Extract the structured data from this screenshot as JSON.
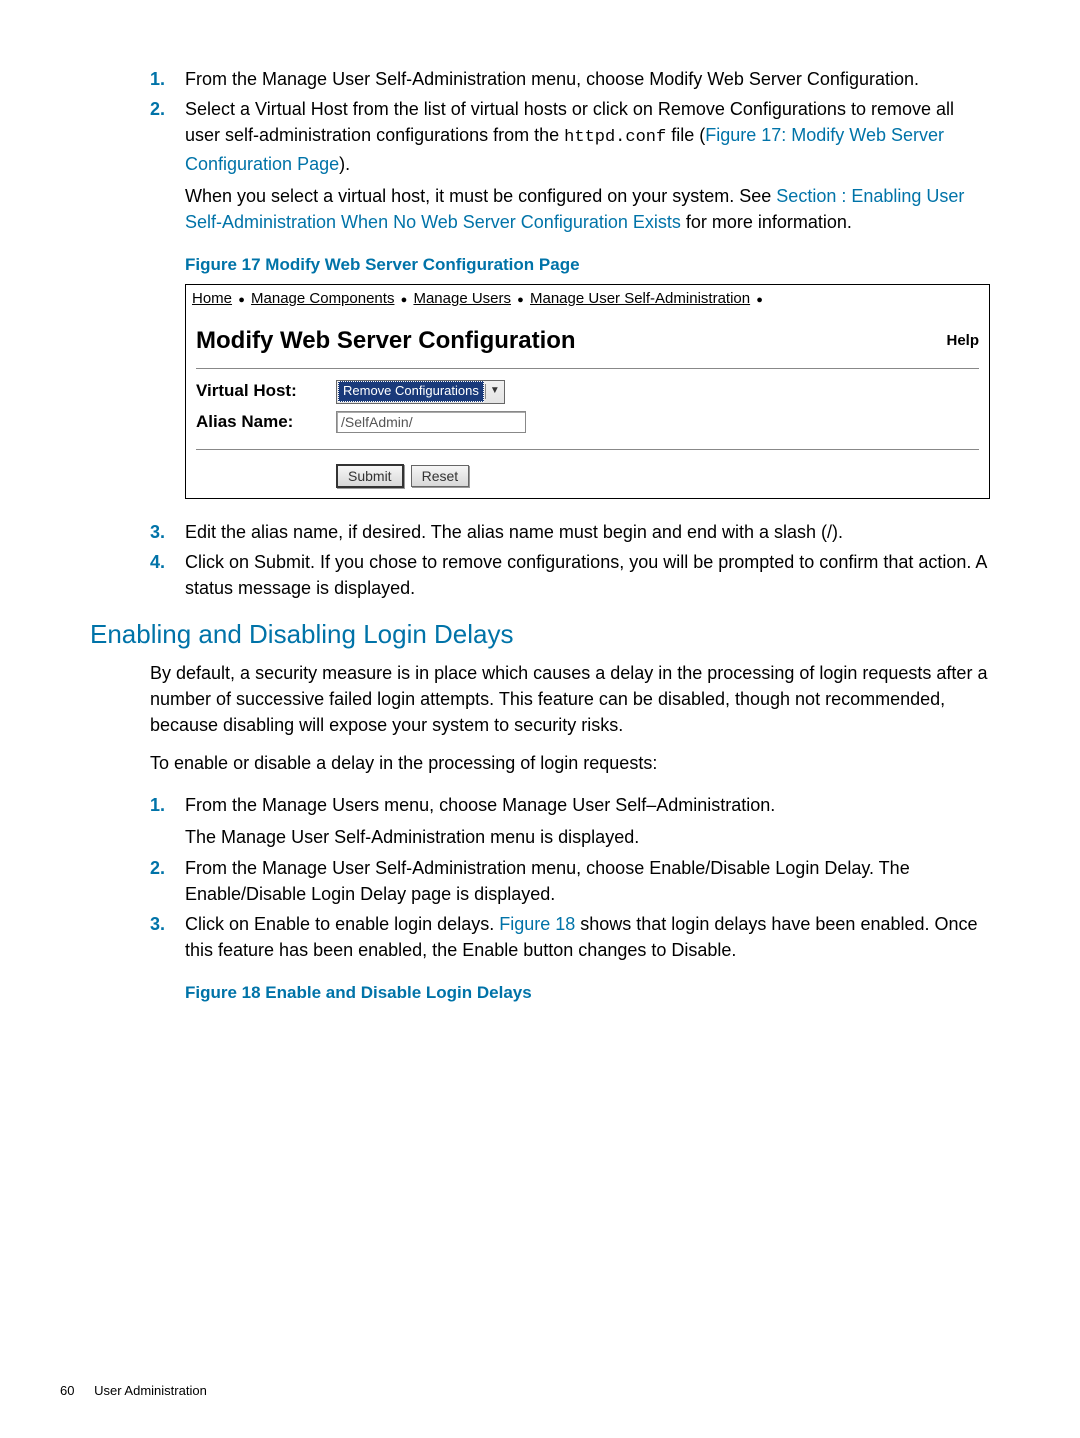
{
  "steps_top": [
    {
      "num": "1.",
      "text": "From the Manage User Self-Administration menu, choose Modify Web Server Configuration."
    },
    {
      "num": "2.",
      "text_before": "Select a Virtual Host from the list of virtual hosts or click on Remove Configurations to remove all user self-administration configurations from the ",
      "code": "httpd.conf",
      "text_after": " file (",
      "link1": "Figure 17: Modify Web Server Configuration Page",
      "tail": ").",
      "para2_before": "When you select a virtual host, it must be configured on your system. See ",
      "para2_link": "Section : Enabling User Self-Administration When No Web Server Configuration Exists",
      "para2_after": " for more information."
    }
  ],
  "fig17": {
    "caption": "Figure 17 Modify Web Server Configuration Page",
    "breadcrumb": [
      "Home",
      "Manage Components",
      "Manage Users",
      "Manage User Self-Administration"
    ],
    "title": "Modify Web Server Configuration",
    "help": "Help",
    "label_vhost": "Virtual Host:",
    "label_alias": "Alias Name:",
    "select_value": "Remove Configurations",
    "input_value": "/SelfAdmin/",
    "btn_submit": "Submit",
    "btn_reset": "Reset"
  },
  "steps_mid": [
    {
      "num": "3.",
      "text": "Edit the alias name, if desired. The alias name must begin and end with a slash (/)."
    },
    {
      "num": "4.",
      "text": "Click on Submit. If you chose to remove configurations, you will be prompted to confirm that action. A status message is displayed."
    }
  ],
  "heading2": "Enabling and Disabling Login Delays",
  "para1": "By default, a security measure is in place which causes a delay in the processing of login requests after a number of successive failed login attempts. This feature can be disabled, though not recommended, because disabling will expose your system to security risks.",
  "para2": "To enable or disable a delay in the processing of login requests:",
  "steps_bot": [
    {
      "num": "1.",
      "text": "From the Manage Users menu, choose Manage User Self–Administration.",
      "sub": "The Manage User Self-Administration menu is displayed."
    },
    {
      "num": "2.",
      "text": "From the Manage User Self-Administration menu, choose Enable/Disable Login Delay. The Enable/Disable Login Delay page is displayed."
    },
    {
      "num": "3.",
      "before": "Click on Enable to enable login delays. ",
      "link": "Figure 18",
      "after": " shows that login delays have been enabled. Once this feature has been enabled, the Enable button changes to Disable."
    }
  ],
  "fig18_caption": "Figure 18 Enable and Disable Login Delays",
  "footer": {
    "page": "60",
    "title": "User Administration"
  }
}
